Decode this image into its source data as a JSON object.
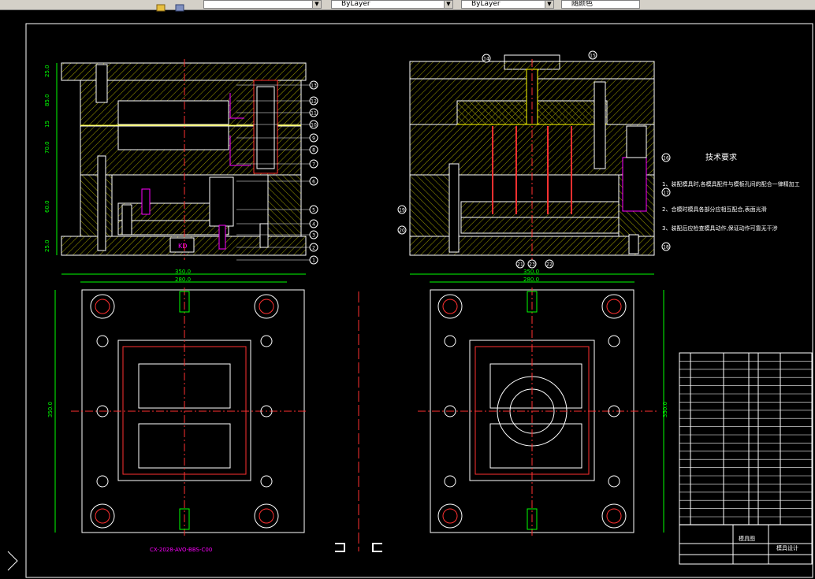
{
  "toolbar": {
    "layer_combo": "",
    "color_combo": "ByLayer",
    "linetype_combo": "ByLayer",
    "lineweight_combo": "随颜色"
  },
  "drawing": {
    "technical_requirements": {
      "title": "技术要求",
      "items": [
        "1、装配模具时,各模具配件与模板孔间的配合一律精加工",
        "2、合模时模具各部分应相互配合,表面光滑",
        "3、装配后应检查模具动作,保证动作可靠无干涉"
      ]
    },
    "dimensions": {
      "left_overall_width": "350.0",
      "left_inner_width": "280.0",
      "left_height": "350.0",
      "right_overall_width": "350.0",
      "right_inner_width": "280.0",
      "right_height": "350.0"
    },
    "vertical_dims_left": [
      "25.0",
      "85.0",
      "15",
      "70.0",
      "60.0",
      "25.0"
    ],
    "part_numbers_left": [
      "13",
      "12",
      "11",
      "10",
      "9",
      "8",
      "7",
      "6",
      "5",
      "4",
      "3",
      "2",
      "1"
    ],
    "part_numbers_right": [
      "14",
      "15",
      "16",
      "17",
      "18",
      "19",
      "20",
      "21",
      "22",
      "23"
    ],
    "mold_label": "CX-2028-AVO-BBS-C00",
    "kd_label": "KD",
    "title_block": {
      "name": "模具图",
      "company": "模具设计"
    }
  }
}
